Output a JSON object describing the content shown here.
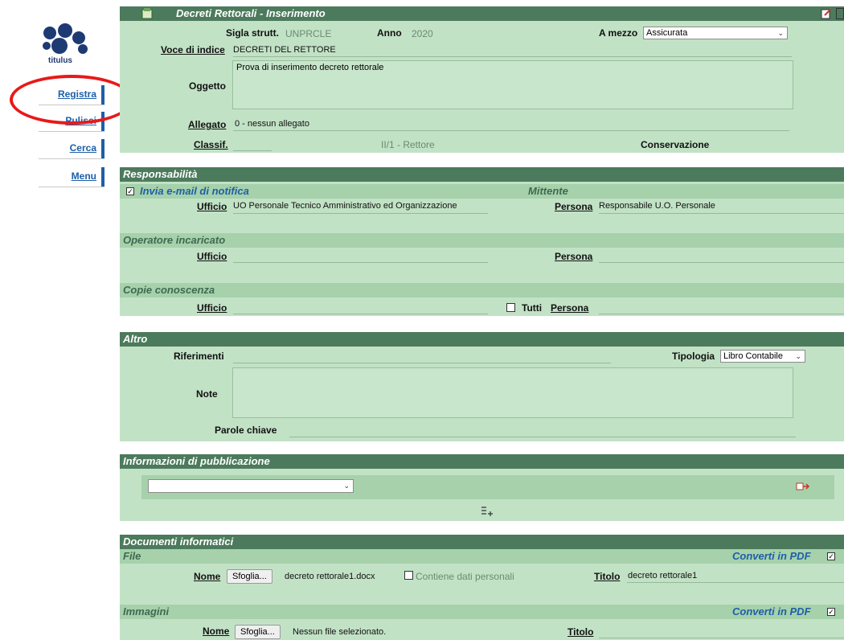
{
  "nav": {
    "logo_text": "titulus",
    "registra": "Registra",
    "pulisci": "Pulisci",
    "cerca": "Cerca",
    "menu": "Menu"
  },
  "main": {
    "title": "Decreti Rettorali - Inserimento",
    "sigla_label": "Sigla strutt.",
    "sigla_value": "UNPRCLE",
    "anno_label": "Anno",
    "anno_value": "2020",
    "mezzo_label": "A mezzo",
    "mezzo_value": "Assicurata",
    "voce_label": "Voce di indice",
    "voce_value": "DECRETI DEL RETTORE",
    "oggetto_label": "Oggetto",
    "oggetto_value": "Prova di inserimento decreto rettorale",
    "allegato_label": "Allegato",
    "allegato_value": "0 - nessun allegato",
    "classif_label": "Classif.",
    "classif_value": "II/1 - Rettore",
    "conservazione_label": "Conservazione"
  },
  "resp": {
    "title": "Responsabilità",
    "notify_label": "Invia e-mail di notifica",
    "mittente_label": "Mittente",
    "ufficio_label": "Ufficio",
    "ufficio_value": "UO Personale Tecnico Amministrativo ed Organizzazione",
    "persona_label": "Persona",
    "persona_value": "Responsabile U.O. Personale",
    "operatore_title": "Operatore incaricato",
    "copie_title": "Copie conoscenza",
    "tutti_label": "Tutti"
  },
  "altro": {
    "title": "Altro",
    "riferimenti_label": "Riferimenti",
    "tipologia_label": "Tipologia",
    "tipologia_value": "Libro Contabile",
    "note_label": "Note",
    "parole_label": "Parole chiave"
  },
  "pub": {
    "title": "Informazioni di pubblicazione",
    "select_value": ""
  },
  "docs": {
    "title": "Documenti informatici",
    "file_title": "File",
    "converti_label": "Converti in PDF",
    "nome_label": "Nome",
    "browse_label": "Sfoglia...",
    "file_name": "decreto rettorale1.docx",
    "dati_label": "Contiene dati personali",
    "titolo_label": "Titolo",
    "titolo_value": "decreto rettorale1",
    "immagini_title": "Immagini",
    "img_file": "Nessun file selezionato."
  },
  "colors": {
    "header": "#4c7a5c",
    "panel": "#c2e2c6",
    "accent": "#1d5fa8",
    "highlight": "#e8191a"
  }
}
